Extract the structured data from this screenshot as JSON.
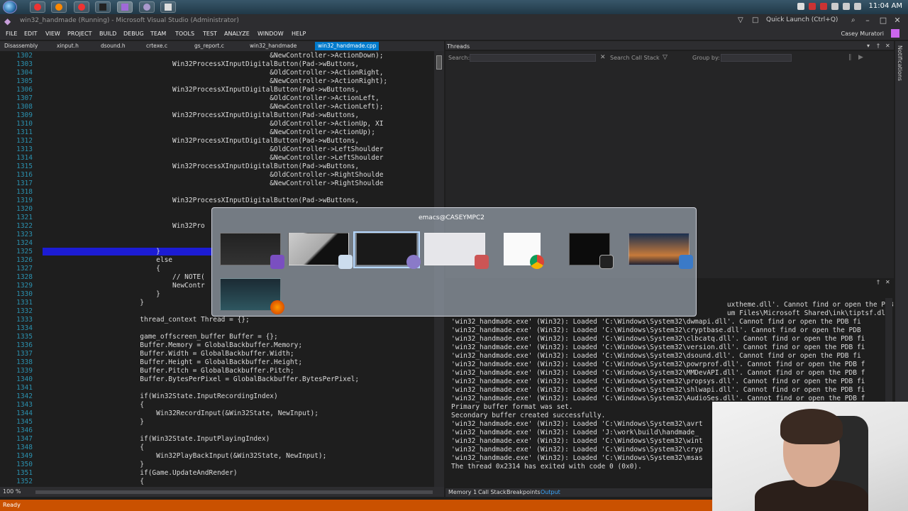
{
  "taskbar": {
    "clock": "11:04 AM",
    "apps": [
      "chrome",
      "firefox",
      "chrome",
      "cmd",
      "visual-studio",
      "emacs",
      "notepad"
    ]
  },
  "window": {
    "title": "win32_handmade (Running) - Microsoft Visual Studio (Administrator)",
    "quick_launch_placeholder": "Quick Launch (Ctrl+Q)",
    "user": "Casey Muratori"
  },
  "menu": [
    "FILE",
    "EDIT",
    "VIEW",
    "PROJECT",
    "BUILD",
    "DEBUG",
    "TEAM",
    "TOOLS",
    "TEST",
    "ANALYZE",
    "WINDOW",
    "HELP"
  ],
  "doc_tabs": [
    "Disassembly",
    "xinput.h",
    "dsound.h",
    "crtexe.c",
    "gs_report.c",
    "win32_handmade",
    "win32_handmade.cpp"
  ],
  "editor": {
    "zoom": "100 %",
    "lines": [
      {
        "n": "1302",
        "t": "                                                        &NewController->ActionDown);"
      },
      {
        "n": "1303",
        "t": "                                Win32ProcessXInputDigitalButton(Pad->wButtons,"
      },
      {
        "n": "1304",
        "t": "                                                        &OldController->ActionRight,"
      },
      {
        "n": "1305",
        "t": "                                                        &NewController->ActionRight);"
      },
      {
        "n": "1306",
        "t": "                                Win32ProcessXInputDigitalButton(Pad->wButtons,"
      },
      {
        "n": "1307",
        "t": "                                                        &OldController->ActionLeft,"
      },
      {
        "n": "1308",
        "t": "                                                        &NewController->ActionLeft);"
      },
      {
        "n": "1309",
        "t": "                                Win32ProcessXInputDigitalButton(Pad->wButtons,"
      },
      {
        "n": "1310",
        "t": "                                                        &OldController->ActionUp, XI"
      },
      {
        "n": "1311",
        "t": "                                                        &NewController->ActionUp);"
      },
      {
        "n": "1312",
        "t": "                                Win32ProcessXInputDigitalButton(Pad->wButtons,"
      },
      {
        "n": "1313",
        "t": "                                                        &OldController->LeftShoulder"
      },
      {
        "n": "1314",
        "t": "                                                        &NewController->LeftShoulder"
      },
      {
        "n": "1315",
        "t": "                                Win32ProcessXInputDigitalButton(Pad->wButtons,"
      },
      {
        "n": "1316",
        "t": "                                                        &OldController->RightShoulde"
      },
      {
        "n": "1317",
        "t": "                                                        &NewController->RightShoulde"
      },
      {
        "n": "1318",
        "t": ""
      },
      {
        "n": "1319",
        "t": "                                Win32ProcessXInputDigitalButton(Pad->wButtons,"
      },
      {
        "n": "1320",
        "t": ""
      },
      {
        "n": "1321",
        "t": ""
      },
      {
        "n": "1322",
        "t": "                                Win32Pro"
      },
      {
        "n": "1323",
        "t": ""
      },
      {
        "n": "1324",
        "t": ""
      },
      {
        "n": "1325",
        "t": "                            }"
      },
      {
        "n": "1326",
        "t": "                            else"
      },
      {
        "n": "1327",
        "t": "                            {"
      },
      {
        "n": "1328",
        "t": "                                // NOTE("
      },
      {
        "n": "1329",
        "t": "                                NewContr"
      },
      {
        "n": "1330",
        "t": "                            }"
      },
      {
        "n": "1331",
        "t": "                        }"
      },
      {
        "n": "1332",
        "t": ""
      },
      {
        "n": "1333",
        "t": "                        thread_context Thread = {};"
      },
      {
        "n": "1334",
        "t": ""
      },
      {
        "n": "1335",
        "t": "                        game_offscreen_buffer Buffer = {};"
      },
      {
        "n": "1336",
        "t": "                        Buffer.Memory = GlobalBackbuffer.Memory;"
      },
      {
        "n": "1337",
        "t": "                        Buffer.Width = GlobalBackbuffer.Width;"
      },
      {
        "n": "1338",
        "t": "                        Buffer.Height = GlobalBackbuffer.Height;"
      },
      {
        "n": "1339",
        "t": "                        Buffer.Pitch = GlobalBackbuffer.Pitch;"
      },
      {
        "n": "1340",
        "t": "                        Buffer.BytesPerPixel = GlobalBackbuffer.BytesPerPixel;"
      },
      {
        "n": "1341",
        "t": ""
      },
      {
        "n": "1342",
        "t": "                        if(Win32State.InputRecordingIndex)"
      },
      {
        "n": "1343",
        "t": "                        {"
      },
      {
        "n": "1344",
        "t": "                            Win32RecordInput(&Win32State, NewInput);"
      },
      {
        "n": "1345",
        "t": "                        }"
      },
      {
        "n": "1346",
        "t": ""
      },
      {
        "n": "1347",
        "t": "                        if(Win32State.InputPlayingIndex)"
      },
      {
        "n": "1348",
        "t": "                        {"
      },
      {
        "n": "1349",
        "t": "                            Win32PlayBackInput(&Win32State, NewInput);"
      },
      {
        "n": "1350",
        "t": "                        }"
      },
      {
        "n": "1351",
        "t": "                        if(Game.UpdateAndRender)"
      },
      {
        "n": "1352",
        "t": "                        {"
      }
    ]
  },
  "threads": {
    "title": "Threads",
    "search_label": "Search:",
    "search_call_stack": "Search Call Stack",
    "group_by": "Group by:"
  },
  "output": {
    "lines": [
      "                                                                    uxtheme.dll'. Cannot find or open the PDB fi",
      "                                                                    um Files\\Microsoft Shared\\ink\\tiptsf.dll'.",
      "'win32_handmade.exe' (Win32): Loaded 'C:\\Windows\\System32\\dwmapi.dll'. Cannot find or open the PDB fi",
      "'win32_handmade.exe' (Win32): Loaded 'C:\\Windows\\System32\\cryptbase.dll'. Cannot find or open the PDB",
      "'win32_handmade.exe' (Win32): Loaded 'C:\\Windows\\System32\\clbcatq.dll'. Cannot find or open the PDB fi",
      "'win32_handmade.exe' (Win32): Loaded 'C:\\Windows\\System32\\version.dll'. Cannot find or open the PDB fi",
      "'win32_handmade.exe' (Win32): Loaded 'C:\\Windows\\System32\\dsound.dll'. Cannot find or open the PDB fi",
      "'win32_handmade.exe' (Win32): Loaded 'C:\\Windows\\System32\\powrprof.dll'. Cannot find or open the PDB f",
      "'win32_handmade.exe' (Win32): Loaded 'C:\\Windows\\System32\\MMDevAPI.dll'. Cannot find or open the PDB f",
      "'win32_handmade.exe' (Win32): Loaded 'C:\\Windows\\System32\\propsys.dll'. Cannot find or open the PDB fi",
      "'win32_handmade.exe' (Win32): Loaded 'C:\\Windows\\System32\\shlwapi.dll'. Cannot find or open the PDB fi",
      "'win32_handmade.exe' (Win32): Loaded 'C:\\Windows\\System32\\AudioSes.dll'. Cannot find or open the PDB f",
      "Primary buffer format was set.",
      "Secondary buffer created successfully.",
      "'win32_handmade.exe' (Win32): Loaded 'C:\\Windows\\System32\\avrt",
      "'win32_handmade.exe' (Win32): Loaded 'J:\\work\\build\\handmade_",
      "'win32_handmade.exe' (Win32): Loaded 'C:\\Windows\\System32\\wint",
      "'win32_handmade.exe' (Win32): Loaded 'C:\\Windows\\System32\\cryp",
      "'win32_handmade.exe' (Win32): Loaded 'C:\\Windows\\System32\\msas",
      "The thread 0x2314 has exited with code 0 (0x0)."
    ]
  },
  "bottom_tabs": [
    "Memory 1",
    "Call Stack",
    "Breakpoints",
    "Output"
  ],
  "status": "Ready",
  "notifications_label": "Notifications",
  "switcher": {
    "title": "emacs@CASEYMPC2",
    "items": [
      "visual-studio",
      "paint",
      "emacs",
      "document",
      "chrome",
      "cmd",
      "game",
      "firefox"
    ]
  },
  "colors": {
    "accent": "#007acc",
    "status_bar": "#ca5100",
    "line_number": "#2b91af",
    "current_line": "#1c1cd4"
  }
}
